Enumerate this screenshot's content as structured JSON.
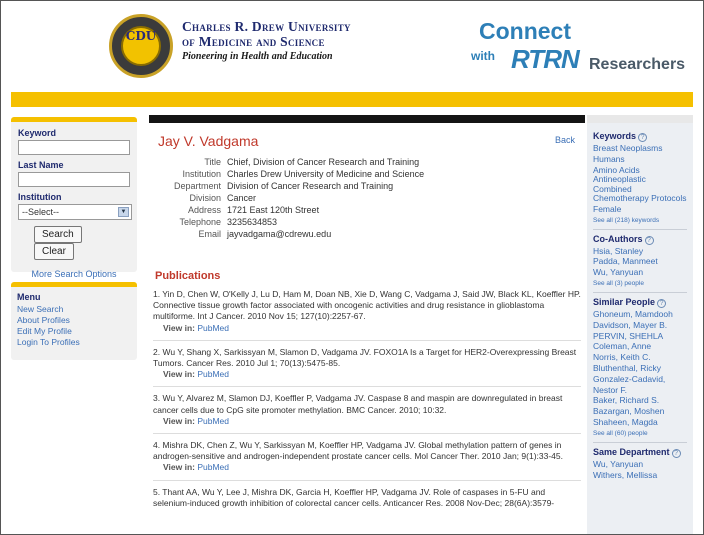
{
  "header": {
    "seal_text": "CDU",
    "univ_line1": "Charles R. Drew University",
    "univ_line2": "of Medicine and Science",
    "univ_tagline": "Pioneering in Health and Education",
    "connect": "Connect",
    "connect_with": "with",
    "connect_brand": "RTRN",
    "connect_researchers": "Researchers"
  },
  "search": {
    "keyword_label": "Keyword",
    "lastname_label": "Last Name",
    "institution_label": "Institution",
    "institution_selected": "--Select--",
    "search_button": "Search",
    "clear_button": "Clear",
    "more_options": "More Search Options"
  },
  "menu": {
    "title": "Menu",
    "items": [
      "New Search",
      "About Profiles",
      "Edit My Profile",
      "Login To Profiles"
    ]
  },
  "profile": {
    "name": "Jay V. Vadgama",
    "back": "Back",
    "fields": [
      {
        "key": "Title",
        "value": "Chief, Division of Cancer Research and Training"
      },
      {
        "key": "Institution",
        "value": "Charles Drew University of Medicine and Science"
      },
      {
        "key": "Department",
        "value": "Division of Cancer Research and Training"
      },
      {
        "key": "Division",
        "value": "Cancer"
      },
      {
        "key": "Address",
        "value": "1721 East 120th Street"
      },
      {
        "key": "Telephone",
        "value": "3235634853"
      },
      {
        "key": "Email",
        "value": "jayvadgama@cdrewu.edu"
      }
    ]
  },
  "publications": {
    "title": "Publications",
    "view_in": "View in:",
    "pubmed": "PubMed",
    "items": [
      "1. Yin D, Chen W, O'Kelly J, Lu D, Ham M, Doan NB, Xie D, Wang C, Vadgama J, Said JW, Black KL, Koeffler HP. Connective tissue growth factor associated with oncogenic activities and drug resistance in glioblastoma multiforme. Int J Cancer. 2010 Nov 15; 127(10):2257-67.",
      "2. Wu Y, Shang X, Sarkissyan M, Slamon D, Vadgama JV. FOXO1A Is a Target for HER2-Overexpressing Breast Tumors. Cancer Res. 2010 Jul 1; 70(13):5475-85.",
      "3. Wu Y, Alvarez M, Slamon DJ, Koeffler P, Vadgama JV. Caspase 8 and maspin are downregulated in breast cancer cells due to CpG site promoter methylation. BMC Cancer. 2010; 10:32.",
      "4. Mishra DK, Chen Z, Wu Y, Sarkissyan M, Koeffler HP, Vadgama JV. Global methylation pattern of genes in androgen-sensitive and androgen-independent prostate cancer cells. Mol Cancer Ther. 2010 Jan; 9(1):33-45.",
      "5. Thant AA, Wu Y, Lee J, Mishra DK, Garcia H, Koeffler HP, Vadgama JV. Role of caspases in 5-FU and selenium-induced growth inhibition of colorectal cancer cells. Anticancer Res. 2008 Nov-Dec; 28(6A):3579-"
    ]
  },
  "right": {
    "keywords": {
      "title": "Keywords",
      "items": [
        "Breast Neoplasms",
        "Humans",
        "Amino Acids",
        "Antineoplastic Combined Chemotherapy Protocols",
        "Female"
      ],
      "see_all": "See all (218) keywords"
    },
    "coauthors": {
      "title": "Co-Authors",
      "items": [
        "Hsia, Stanley",
        "Padda, Manmeet",
        "Wu, Yanyuan"
      ],
      "see_all": "See all (3) people"
    },
    "similar": {
      "title": "Similar People",
      "items": [
        "Ghoneum, Mamdooh",
        "Davidson, Mayer B.",
        "PERVIN, SHEHLA",
        "Coleman, Anne",
        "Norris, Keith C.",
        "Bluthenthal, Ricky",
        "Gonzalez-Cadavid, Nestor F.",
        "Baker, Richard S.",
        "Bazargan, Moshen",
        "Shaheen, Magda"
      ],
      "see_all": "See all (60) people"
    },
    "same_department": {
      "title": "Same Department",
      "items": [
        "Wu, Yanyuan",
        "Withers, Mellissa"
      ]
    }
  },
  "colors": {
    "accent_yellow": "#f5c000",
    "name_red": "#c0392b",
    "link_blue": "#3b6fb6",
    "heading_navy": "#1f2a6e"
  }
}
